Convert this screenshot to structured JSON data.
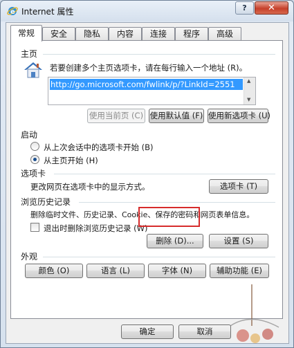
{
  "window": {
    "title": "Internet 属性",
    "help_label": "?",
    "close_label": "✕"
  },
  "tabs": [
    {
      "label": "常规"
    },
    {
      "label": "安全"
    },
    {
      "label": "隐私"
    },
    {
      "label": "内容"
    },
    {
      "label": "连接"
    },
    {
      "label": "程序"
    },
    {
      "label": "高级"
    }
  ],
  "homepage": {
    "section_label": "主页",
    "instruction": "若要创建多个主页选项卡，请在每行输入一个地址 (R)。",
    "url": "http://go.microsoft.com/fwlink/p/?LinkId=2551",
    "use_current_label": "使用当前页 (C)",
    "use_default_label": "使用默认值 (F)",
    "use_new_tab_label": "使用新选项卡 (U)"
  },
  "startup": {
    "section_label": "启动",
    "option_last_session": "从上次会话中的选项卡开始 (B)",
    "option_homepage": "从主页开始 (H)",
    "selected": "option_homepage"
  },
  "tabs_section": {
    "section_label": "选项卡",
    "description": "更改网页在选项卡中的显示方式。",
    "button_label": "选项卡 (T)"
  },
  "history": {
    "section_label": "浏览历史记录",
    "description": "删除临时文件、历史记录、Cookie、保存的密码和网页表单信息。",
    "delete_on_exit_label": "退出时删除浏览历史记录 (W)",
    "delete_on_exit_checked": false,
    "delete_label": "删除 (D)...",
    "settings_label": "设置 (S)"
  },
  "appearance": {
    "section_label": "外观",
    "colors_label": "颜色 (O)",
    "languages_label": "语言 (L)",
    "fonts_label": "字体 (N)",
    "accessibility_label": "辅助功能 (E)"
  },
  "footer": {
    "ok_label": "确定",
    "cancel_label": "取消"
  },
  "colors": {
    "highlight_border": "#d62b2b",
    "selection": "#3399ff"
  }
}
